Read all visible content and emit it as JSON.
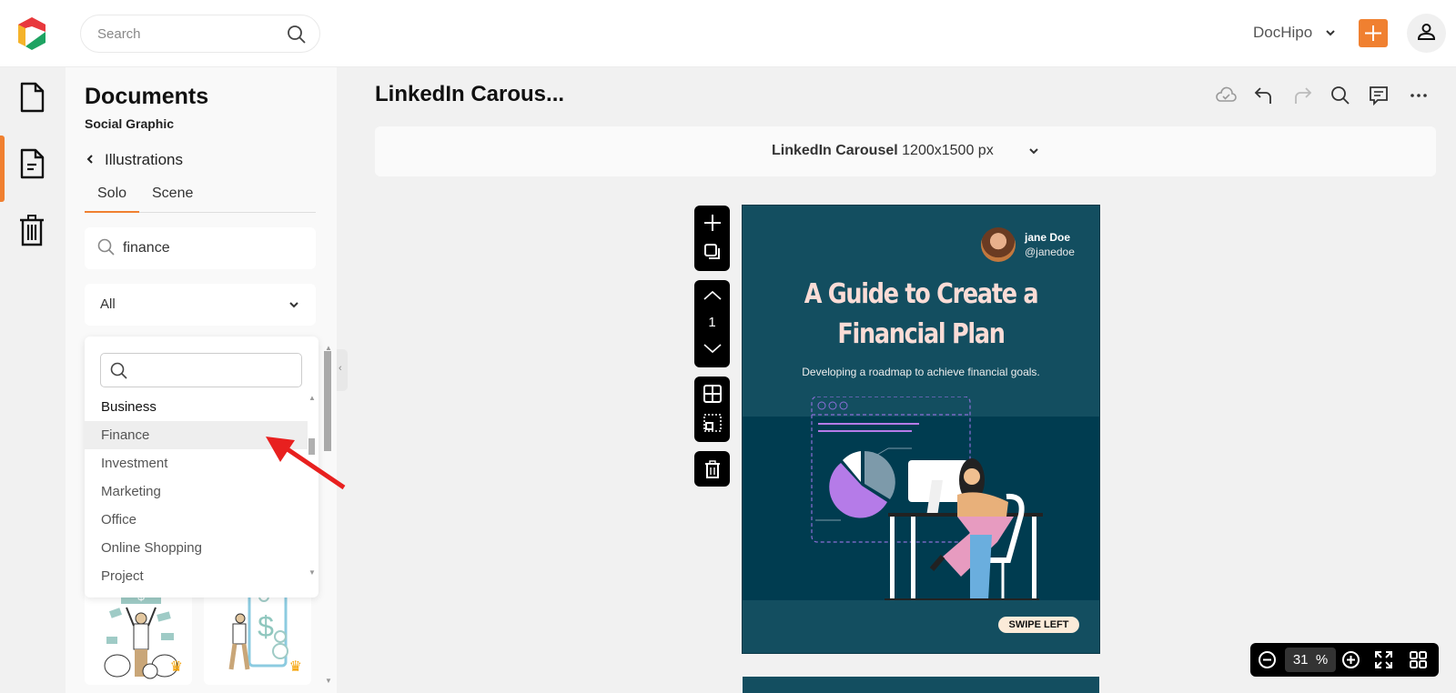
{
  "topbar": {
    "search_placeholder": "Search",
    "brand": "DocHipo"
  },
  "rail": {
    "items": [
      {
        "name": "documents",
        "icon": "file-icon"
      },
      {
        "name": "templates",
        "icon": "file-text-icon",
        "active": true
      },
      {
        "name": "trash",
        "icon": "trash-icon"
      }
    ]
  },
  "panel": {
    "title": "Documents",
    "subtitle": "Social Graphic",
    "back_label": "Illustrations",
    "tabs": [
      {
        "label": "Solo",
        "active": true
      },
      {
        "label": "Scene",
        "active": false
      }
    ],
    "search_value": "finance",
    "category_selected": "All",
    "dropdown": {
      "search_placeholder": "",
      "group": "Business",
      "items": [
        "Finance",
        "Investment",
        "Marketing",
        "Office",
        "Online Shopping",
        "Project"
      ],
      "highlighted": "Finance"
    },
    "thumbnails": [
      {
        "name": "money-celebration-illustration",
        "premium": true
      },
      {
        "name": "phone-payment-illustration",
        "premium": true
      }
    ]
  },
  "main": {
    "doc_title": "LinkedIn Carous...",
    "size_label": "LinkedIn Carousel",
    "size_dims": "1200x1500 px",
    "page_number": "1",
    "zoom_value": "31",
    "zoom_unit": "%"
  },
  "canvas": {
    "author_name": "jane Doe",
    "author_handle": "@janedoe",
    "heading_line1": "A Guide to Create a",
    "heading_line2": "Financial Plan",
    "subheading": "Developing a roadmap to achieve financial goals.",
    "cta": "SWIPE LEFT"
  },
  "colors": {
    "accent": "#f08030",
    "canvas_bg": "#134e60",
    "canvas_band": "#003c50",
    "heading": "#fbdcd6",
    "pie_purple": "#b57be8",
    "pie_gray": "#7d9aaa"
  }
}
